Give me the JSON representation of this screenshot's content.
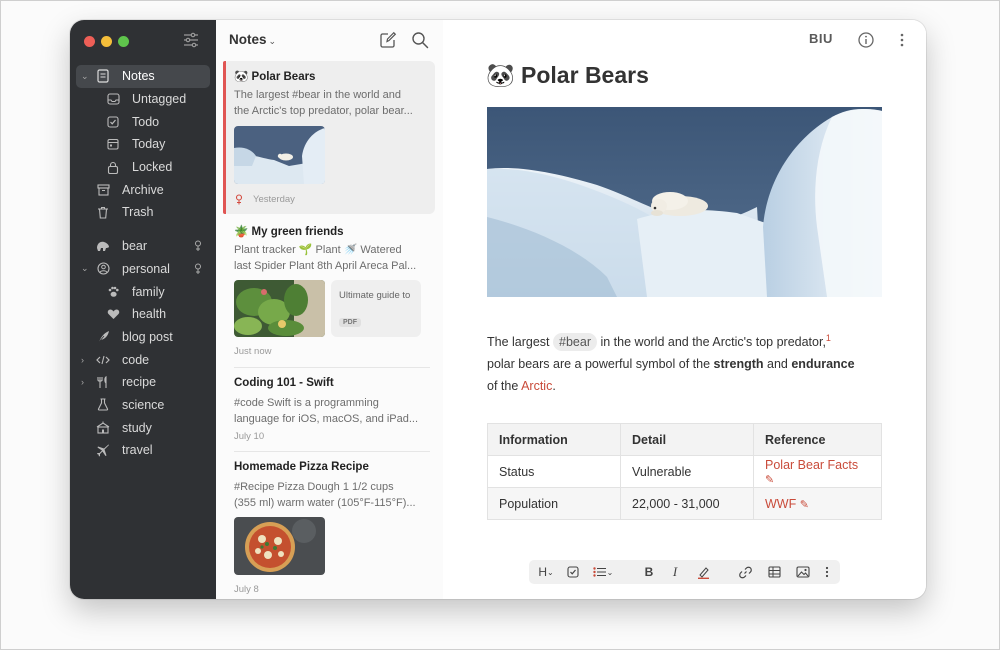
{
  "app": {
    "accent_color": "#e05553",
    "window_controls": [
      "close",
      "minimize",
      "zoom"
    ]
  },
  "sidebar": {
    "items": [
      {
        "label": "Notes",
        "icon": "notes-icon",
        "expanded": true,
        "active": true
      },
      {
        "label": "Untagged",
        "icon": "tray-icon"
      },
      {
        "label": "Todo",
        "icon": "checkbox-icon"
      },
      {
        "label": "Today",
        "icon": "calendar-icon"
      },
      {
        "label": "Locked",
        "icon": "lock-icon"
      },
      {
        "label": "Archive",
        "icon": "archive-icon"
      },
      {
        "label": "Trash",
        "icon": "trash-icon"
      },
      {
        "label": "bear",
        "icon": "bear-icon",
        "pinned": true
      },
      {
        "label": "personal",
        "icon": "person-icon",
        "pinned": true,
        "expanded": true
      },
      {
        "label": "family",
        "icon": "paw-icon"
      },
      {
        "label": "health",
        "icon": "heart-icon"
      },
      {
        "label": "blog post",
        "icon": "feather-icon"
      },
      {
        "label": "code",
        "icon": "code-icon",
        "collapsed": true
      },
      {
        "label": "recipe",
        "icon": "recipe-icon",
        "collapsed": true
      },
      {
        "label": "science",
        "icon": "flask-icon"
      },
      {
        "label": "study",
        "icon": "study-icon"
      },
      {
        "label": "travel",
        "icon": "airplane-icon"
      }
    ]
  },
  "notelist": {
    "title": "Notes",
    "notes": [
      {
        "emoji": "🐼",
        "title": "Polar Bears",
        "line1": "The largest #bear in the world and",
        "line2": "the Arctic's top predator, polar bear...",
        "date": "Yesterday"
      },
      {
        "emoji": "🪴",
        "title": "My green friends",
        "line1": "Plant tracker 🌱 Plant 🚿 Watered",
        "line2": "last Spider Plant 8th April Areca Pal...",
        "attachment_title": "Ultimate guide to",
        "attachment_type": "PDF",
        "date": "Just now"
      },
      {
        "title": "Coding 101 - Swift",
        "line1": "#code Swift is a programming",
        "line2": "language for iOS, macOS, and iPad...",
        "date": "July 10"
      },
      {
        "title": "Homemade Pizza Recipe",
        "line1": "#Recipe Pizza Dough 1 1/2 cups",
        "line2": "(355 ml) warm water (105°F-115°F)...",
        "date": "July 8"
      }
    ]
  },
  "editor": {
    "format_label": "BIU",
    "title_emoji": "🐼",
    "title": "Polar Bears",
    "para": {
      "t1": "The largest",
      "tag": "#bear",
      "t2": "in the world and the Arctic's top predator,",
      "footnote": "1",
      "t3": "polar bears are a powerful symbol of the",
      "b1": "strength",
      "t4": "and",
      "b2": "endurance",
      "t5": "of the",
      "link": "Arctic",
      "t6": "."
    },
    "table": {
      "headers": [
        "Information",
        "Detail",
        "Reference"
      ],
      "rows": [
        [
          "Status",
          "Vulnerable",
          "Polar Bear Facts"
        ],
        [
          "Population",
          "22,000 - 31,000",
          "WWF"
        ]
      ]
    },
    "toolbar": {
      "heading_label": "H",
      "bold_label": "B",
      "italic_label": "I"
    }
  }
}
